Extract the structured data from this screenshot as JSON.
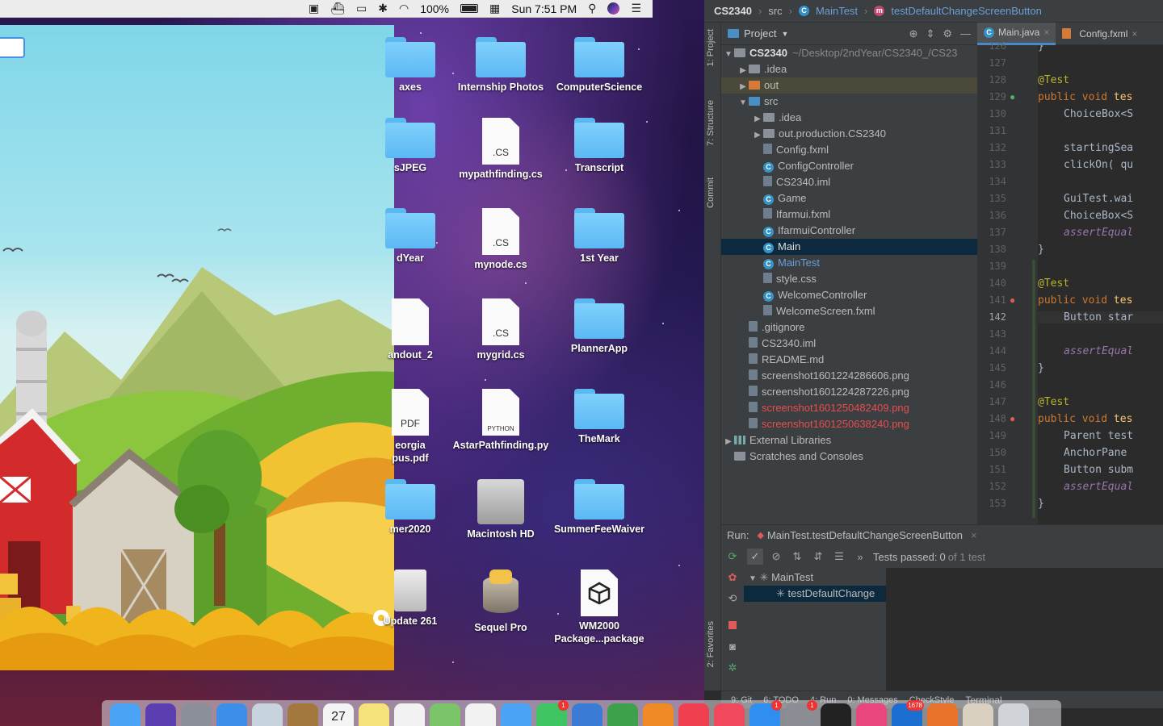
{
  "menubar": {
    "battery": "100%",
    "datetime": "Sun 7:51 PM",
    "icons": [
      "dropbox-icon",
      "docker-icon",
      "airplay-icon",
      "bluetooth-icon",
      "wifi-icon",
      "battery-icon",
      "calendar-icon",
      "spotlight-icon",
      "siri-icon",
      "notification-center-icon"
    ]
  },
  "desktop_icons": [
    {
      "label": "axes",
      "kind": "folder"
    },
    {
      "label": "Internship Photos",
      "kind": "folder"
    },
    {
      "label": "ComputerScience",
      "kind": "folder"
    },
    {
      "label": "sJPEG",
      "kind": "folder"
    },
    {
      "label": "mypathfinding.cs",
      "kind": "doc",
      "ext": ".CS"
    },
    {
      "label": "Transcript",
      "kind": "folder"
    },
    {
      "label": "dYear",
      "kind": "folder"
    },
    {
      "label": "mynode.cs",
      "kind": "doc",
      "ext": ".CS"
    },
    {
      "label": "1st Year",
      "kind": "folder"
    },
    {
      "label": "andout_2",
      "kind": "doc",
      "ext": ""
    },
    {
      "label": "mygrid.cs",
      "kind": "doc",
      "ext": ".CS"
    },
    {
      "label": "PlannerApp",
      "kind": "folder"
    },
    {
      "label": "eorgia\npus.pdf",
      "kind": "doc",
      "ext": "PDF"
    },
    {
      "label": "AstarPathfinding.py",
      "kind": "doc",
      "ext": "PYTHON"
    },
    {
      "label": "TheMark",
      "kind": "folder"
    },
    {
      "label": "mer2020",
      "kind": "folder"
    },
    {
      "label": "Macintosh HD",
      "kind": "disk"
    },
    {
      "label": "SummerFeeWaiver",
      "kind": "folder"
    },
    {
      "label": "Update 261",
      "kind": "drive"
    },
    {
      "label": "Sequel Pro",
      "kind": "app"
    },
    {
      "label": "WM2000\nPackage...package",
      "kind": "unity"
    }
  ],
  "ide": {
    "breadcrumb": [
      "CS2340",
      "src",
      "MainTest",
      "testDefaultChangeScreenButton"
    ],
    "side_tabs": [
      "1: Project",
      "7: Structure",
      "Commit",
      "2: Favorites"
    ],
    "project_header": "Project",
    "tree": [
      {
        "label": "CS2340",
        "extra": "~/Desktop/2ndYear/CS2340_/CS23",
        "depth": 0,
        "arrow": "▼",
        "icon": "dir",
        "style": "bold"
      },
      {
        "label": ".idea",
        "depth": 1,
        "arrow": "▶",
        "icon": "dir"
      },
      {
        "label": "out",
        "depth": 1,
        "arrow": "▶",
        "icon": "out",
        "style": "hl"
      },
      {
        "label": "src",
        "depth": 1,
        "arrow": "▼",
        "icon": "src"
      },
      {
        "label": ".idea",
        "depth": 2,
        "arrow": "▶",
        "icon": "dir"
      },
      {
        "label": "out.production.CS2340",
        "depth": 2,
        "arrow": "▶",
        "icon": "dir"
      },
      {
        "label": "Config.fxml",
        "depth": 2,
        "icon": "file"
      },
      {
        "label": "ConfigController",
        "depth": 2,
        "icon": "class"
      },
      {
        "label": "CS2340.iml",
        "depth": 2,
        "icon": "file"
      },
      {
        "label": "Game",
        "depth": 2,
        "icon": "class"
      },
      {
        "label": "Ifarmui.fxml",
        "depth": 2,
        "icon": "file"
      },
      {
        "label": "IfarmuiController",
        "depth": 2,
        "icon": "class"
      },
      {
        "label": "Main",
        "depth": 2,
        "icon": "class",
        "style": "sel"
      },
      {
        "label": "MainTest",
        "depth": 2,
        "icon": "class",
        "style": "blue"
      },
      {
        "label": "style.css",
        "depth": 2,
        "icon": "file"
      },
      {
        "label": "WelcomeController",
        "depth": 2,
        "icon": "class"
      },
      {
        "label": "WelcomeScreen.fxml",
        "depth": 2,
        "icon": "file"
      },
      {
        "label": ".gitignore",
        "depth": 1,
        "icon": "file"
      },
      {
        "label": "CS2340.iml",
        "depth": 1,
        "icon": "file"
      },
      {
        "label": "README.md",
        "depth": 1,
        "icon": "file"
      },
      {
        "label": "screenshot1601224286606.png",
        "depth": 1,
        "icon": "file"
      },
      {
        "label": "screenshot1601224287226.png",
        "depth": 1,
        "icon": "file"
      },
      {
        "label": "screenshot1601250482409.png",
        "depth": 1,
        "icon": "file",
        "style": "red"
      },
      {
        "label": "screenshot1601250638240.png",
        "depth": 1,
        "icon": "file",
        "style": "red"
      },
      {
        "label": "External Libraries",
        "depth": 0,
        "arrow": "▶",
        "icon": "lib"
      },
      {
        "label": "Scratches and Consoles",
        "depth": 0,
        "icon": "scratch"
      }
    ],
    "editor_tabs": [
      "Main.java",
      "Config.fxml"
    ],
    "line_numbers": [
      "126",
      "127",
      "128",
      "129",
      "130",
      "131",
      "132",
      "133",
      "134",
      "135",
      "136",
      "137",
      "138",
      "139",
      "140",
      "141",
      "142",
      "143",
      "144",
      "145",
      "146",
      "147",
      "148",
      "149",
      "150",
      "151",
      "152",
      "153"
    ],
    "current_line": "142",
    "code_lines": [
      {
        "n": 0,
        "text": "}",
        "indent": 0
      },
      {
        "n": 2,
        "text": "@Test",
        "cls": "ann",
        "indent": 0
      },
      {
        "n": 3,
        "text": "public void tes",
        "cls": "kwline",
        "indent": 0
      },
      {
        "n": 4,
        "text": "ChoiceBox<S",
        "indent": 1
      },
      {
        "n": 6,
        "text": "startingSea",
        "indent": 1
      },
      {
        "n": 7,
        "text": "clickOn( qu",
        "indent": 1
      },
      {
        "n": 9,
        "text": "GuiTest.wai",
        "indent": 1
      },
      {
        "n": 10,
        "text": "ChoiceBox<S",
        "indent": 1
      },
      {
        "n": 11,
        "text": "assertEqual",
        "cls": "it",
        "indent": 1
      },
      {
        "n": 12,
        "text": "}",
        "indent": 0
      },
      {
        "n": 14,
        "text": "@Test",
        "cls": "ann",
        "indent": 0
      },
      {
        "n": 15,
        "text": "public void tes",
        "cls": "kwline",
        "indent": 0
      },
      {
        "n": 16,
        "text": "Button star",
        "indent": 1,
        "cur": true
      },
      {
        "n": 18,
        "text": "assertEqual",
        "cls": "it",
        "indent": 1
      },
      {
        "n": 19,
        "text": "}",
        "indent": 0
      },
      {
        "n": 21,
        "text": "@Test",
        "cls": "ann",
        "indent": 0
      },
      {
        "n": 22,
        "text": "public void tes",
        "cls": "kwline",
        "indent": 0
      },
      {
        "n": 23,
        "text": "Parent test",
        "indent": 1
      },
      {
        "n": 24,
        "text": "AnchorPane",
        "indent": 1
      },
      {
        "n": 25,
        "text": "Button subm",
        "indent": 1
      },
      {
        "n": 26,
        "text": "assertEqual",
        "cls": "it",
        "indent": 1
      },
      {
        "n": 27,
        "text": "}",
        "indent": 0
      }
    ],
    "run": {
      "label": "Run:",
      "config": "MainTest.testDefaultChangeScreenButton",
      "status": "Tests passed:",
      "status_count": "0",
      "status_suffix": "of 1 test",
      "tree": [
        "MainTest",
        "testDefaultChange"
      ]
    },
    "bottom_tabs": [
      "9: Git",
      "6: TODO",
      "4: Run",
      "0: Messages",
      "CheckStyle",
      "Terminal"
    ]
  },
  "dock": [
    {
      "name": "finder-icon",
      "color": "#4aa3f5"
    },
    {
      "name": "siri-icon",
      "color": "#5b3fb0"
    },
    {
      "name": "launchpad-icon",
      "color": "#8a8f99"
    },
    {
      "name": "safari-icon",
      "color": "#3d8ee8"
    },
    {
      "name": "preview-icon",
      "color": "#c8d3e0"
    },
    {
      "name": "contacts-icon",
      "color": "#a3783e"
    },
    {
      "name": "calendar-icon",
      "color": "#f4f4f4",
      "text": "27"
    },
    {
      "name": "notes-icon",
      "color": "#f6e27a"
    },
    {
      "name": "reminders-icon",
      "color": "#f2f2f2"
    },
    {
      "name": "maps-icon",
      "color": "#7cc46a"
    },
    {
      "name": "photos-icon",
      "color": "#f2f2f2"
    },
    {
      "name": "messages-icon",
      "color": "#4aa3f5"
    },
    {
      "name": "facetime-icon",
      "color": "#3ec460",
      "badge": "1"
    },
    {
      "name": "keynote-icon",
      "color": "#3a7bd5"
    },
    {
      "name": "numbers-icon",
      "color": "#3ea04a"
    },
    {
      "name": "pages-icon",
      "color": "#f08a24"
    },
    {
      "name": "news-icon",
      "color": "#f04050"
    },
    {
      "name": "music-icon",
      "color": "#f0485c"
    },
    {
      "name": "app-store-icon",
      "color": "#2f8ef0",
      "badge": "1"
    },
    {
      "name": "system-preferences-icon",
      "color": "#8a8d93",
      "badge": "1"
    },
    {
      "name": "terminal-icon",
      "color": "#222222"
    },
    {
      "name": "intellij-icon",
      "color": "#e8467c"
    },
    {
      "name": "outlook-icon",
      "color": "#1c6fd1",
      "badge": "1678"
    },
    {
      "name": "sublime-icon",
      "color": "#e8742b"
    },
    {
      "name": "coffee-icon",
      "color": "#d9d0c0"
    },
    {
      "name": "trash-icon",
      "color": "#cfd3d8"
    }
  ]
}
